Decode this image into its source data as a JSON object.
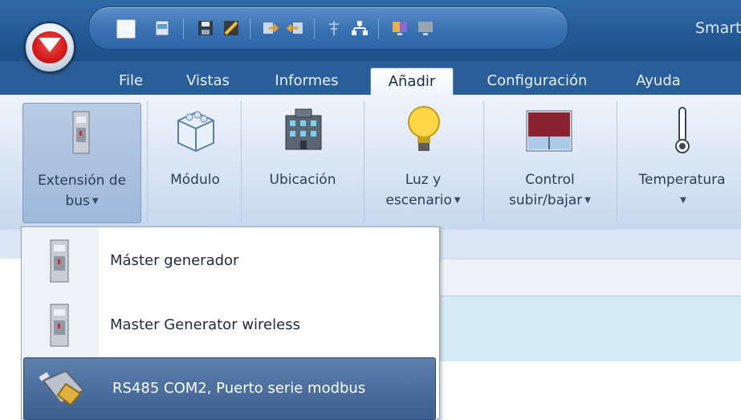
{
  "window": {
    "title": "Smart"
  },
  "quick_access": {
    "icons": [
      "new-document-icon",
      "print-icon",
      "save-icon",
      "edit-icon",
      "import-icon",
      "export-icon",
      "antenna-icon",
      "network-icon",
      "monitor-color-icon",
      "monitor-gray-icon"
    ]
  },
  "tabs": [
    {
      "label": "File"
    },
    {
      "label": "Vistas"
    },
    {
      "label": "Informes"
    },
    {
      "label": "Añadir",
      "active": true
    },
    {
      "label": "Configuración"
    },
    {
      "label": "Ayuda"
    }
  ],
  "ribbon": {
    "extension": {
      "line1": "Extensión de",
      "line2": "bus"
    },
    "modulo": {
      "label": "Módulo"
    },
    "ubicacion": {
      "label": "Ubicación"
    },
    "luz": {
      "line1": "Luz y",
      "line2": "escenario"
    },
    "control": {
      "line1": "Control",
      "line2": "subir/bajar"
    },
    "temperatura": {
      "label": "Temperatura"
    }
  },
  "dropdown": {
    "items": [
      {
        "label": "Máster generador",
        "icon": "bus-module-icon"
      },
      {
        "label": "Master Generator wireless",
        "icon": "bus-module-icon"
      },
      {
        "label": "RS485 COM2, Puerto serie modbus",
        "icon": "serial-connector-icon",
        "highlighted": true
      }
    ]
  },
  "colors": {
    "accent": "#2a5e99",
    "highlight": "#4a6d9e",
    "ribbon_bg": "#dfe9f6"
  }
}
